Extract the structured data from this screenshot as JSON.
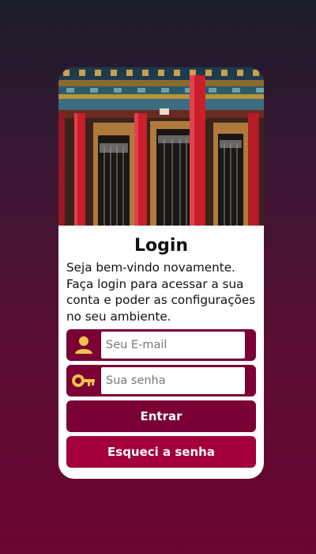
{
  "login": {
    "title": "Login",
    "description": "Seja bem-vindo novamente. Faça login para acessar a sua conta e poder as configurações no seu ambiente.",
    "email": {
      "placeholder": "Seu E-mail",
      "value": "",
      "icon": "user-icon"
    },
    "password": {
      "placeholder": "Sua senha",
      "value": "",
      "icon": "key-icon"
    },
    "submit_label": "Entrar",
    "forgot_label": "Esqueci a senha"
  },
  "hero_image": {
    "description": "red-pillared-temple-facade"
  },
  "colors": {
    "primary": "#7a0035",
    "secondary": "#a3003b",
    "icon": "#f2c14e",
    "card": "#ffffff"
  }
}
